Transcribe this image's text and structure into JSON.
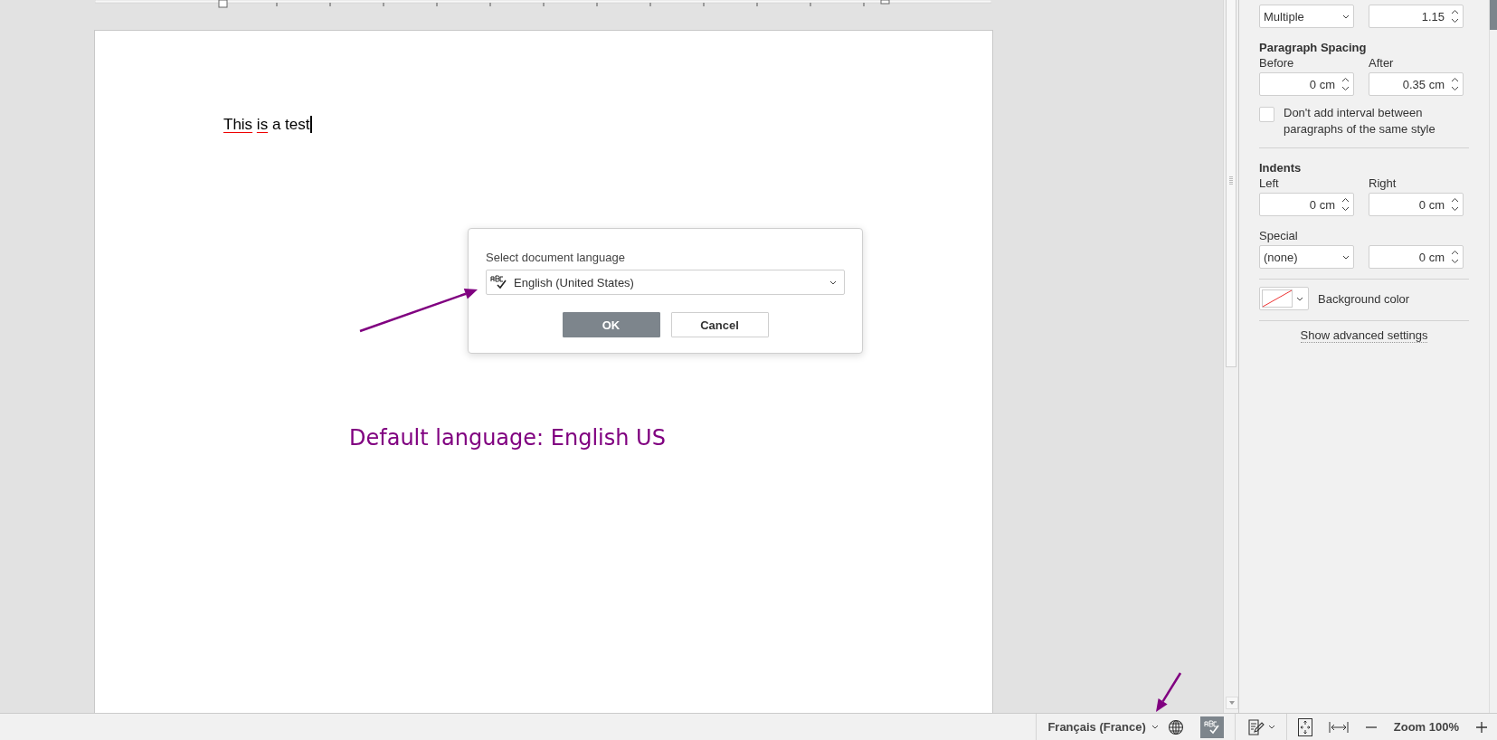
{
  "document": {
    "words": [
      {
        "text": "This",
        "misspelled": true
      },
      {
        "text": "is",
        "misspelled": true
      },
      {
        "text": "a",
        "misspelled": false
      },
      {
        "text": "test",
        "misspelled": false
      }
    ],
    "cursor": true
  },
  "dialog": {
    "label": "Select document language",
    "language": "English (United States)",
    "buttons": [
      {
        "label": "OK",
        "kind": "primary"
      },
      {
        "label": "Cancel",
        "kind": "secondary"
      }
    ]
  },
  "annotation": {
    "text": "Default language: English US"
  },
  "right_panel": {
    "line_spacing": [
      {
        "kind": "select",
        "value": "Multiple"
      },
      {
        "kind": "spin",
        "value": "1.15"
      }
    ],
    "paragraph_spacing": {
      "heading": "Paragraph Spacing",
      "fields": [
        {
          "label": "Before",
          "value": "0 cm"
        },
        {
          "label": "After",
          "value": "0.35 cm"
        }
      ]
    },
    "no_interval": {
      "label": "Don't add interval between paragraphs of the same style",
      "checked": false
    },
    "indents": {
      "heading": "Indents",
      "fields": [
        {
          "label": "Left",
          "value": "0 cm"
        },
        {
          "label": "Right",
          "value": "0 cm"
        }
      ]
    },
    "special": {
      "label": "Special",
      "fields": [
        {
          "kind": "select",
          "value": "(none)"
        },
        {
          "kind": "spin",
          "value": "0 cm"
        }
      ]
    },
    "background_color": {
      "label": "Background color"
    },
    "advanced_link": "Show advanced settings"
  },
  "status_bar": {
    "language": "Français (France)",
    "spell_check": {
      "on": true
    },
    "zoom": "Zoom 100%"
  }
}
